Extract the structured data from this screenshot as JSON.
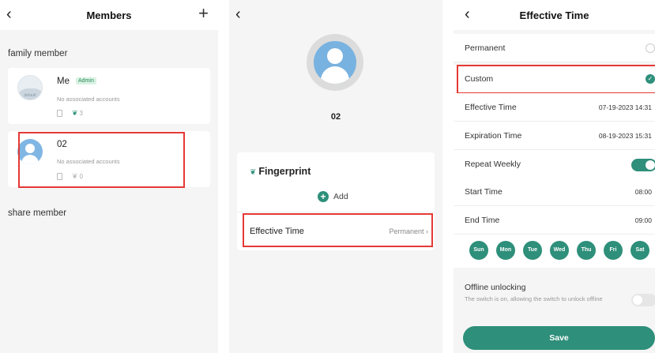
{
  "members_screen": {
    "title": "Members",
    "back_icon": "‹",
    "add_icon": "+",
    "family_label": "family member",
    "share_label": "share member",
    "members": [
      {
        "name": "Me",
        "badge": "Admin",
        "sub": "No associated accounts",
        "avatar_caption": "default",
        "fingerprint_count": "3"
      },
      {
        "name": "02",
        "sub": "No associated accounts",
        "fingerprint_count": "0"
      }
    ]
  },
  "member_detail_screen": {
    "back_icon": "‹",
    "member_id": "02",
    "fingerprint_title": "Fingerprint",
    "add_label": "Add",
    "effective_time_label": "Effective Time",
    "effective_time_value": "Permanent"
  },
  "effective_time_screen": {
    "back_icon": "‹",
    "title": "Effective Time",
    "permanent_label": "Permanent",
    "custom_label": "Custom",
    "effective_time_label": "Effective Time",
    "effective_time_value": "07-19-2023 14:31",
    "expiration_time_label": "Expiration Time",
    "expiration_time_value": "08-19-2023 15:31",
    "repeat_weekly_label": "Repeat Weekly",
    "repeat_weekly_on": true,
    "start_time_label": "Start Time",
    "start_time_value": "08:00",
    "end_time_label": "End Time",
    "end_time_value": "09:00",
    "days": [
      "Sun",
      "Mon",
      "Tue",
      "Wed",
      "Thu",
      "Fri",
      "Sat"
    ],
    "offline_title": "Offline unlocking",
    "offline_desc": "The switch is on, allowing the switch to unlock offline",
    "offline_on": false,
    "save_label": "Save"
  },
  "colors": {
    "accent": "#2e8f7a",
    "highlight": "#e53935",
    "background": "#f5f5f5"
  }
}
